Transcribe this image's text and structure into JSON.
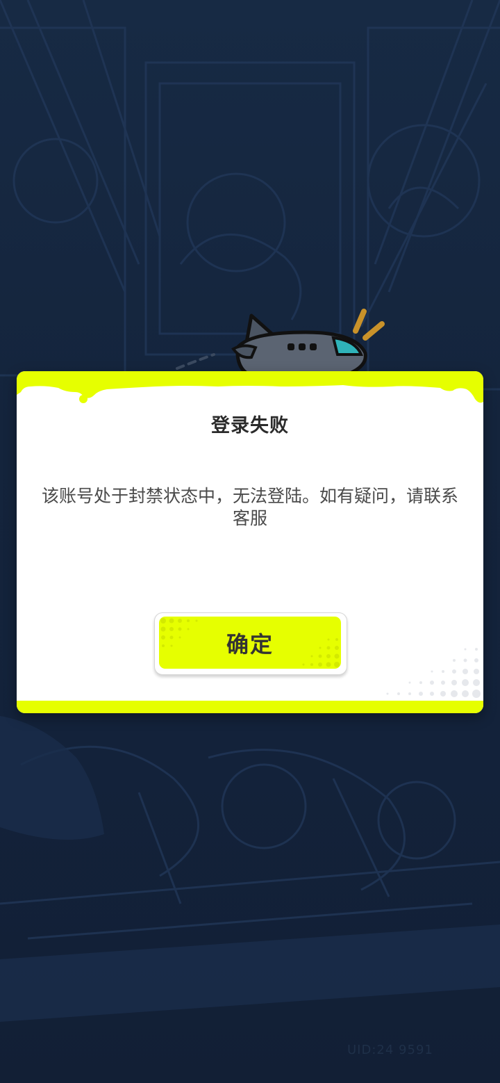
{
  "dialog": {
    "title": "登录失败",
    "message": "该账号处于封禁状态中，无法登陆。如有疑问，请联系客服",
    "confirm_label": "确定"
  },
  "footer": {
    "uid_text": "UID:24 9591"
  },
  "colors": {
    "background": "#13213a",
    "accent": "#e6ff00",
    "modal_bg": "#ffffff",
    "title_text": "#2b2b2b",
    "body_text": "#4a4a4a"
  },
  "icons": {
    "mascot": "airplane-icon",
    "motion": "motion-lines-icon"
  }
}
